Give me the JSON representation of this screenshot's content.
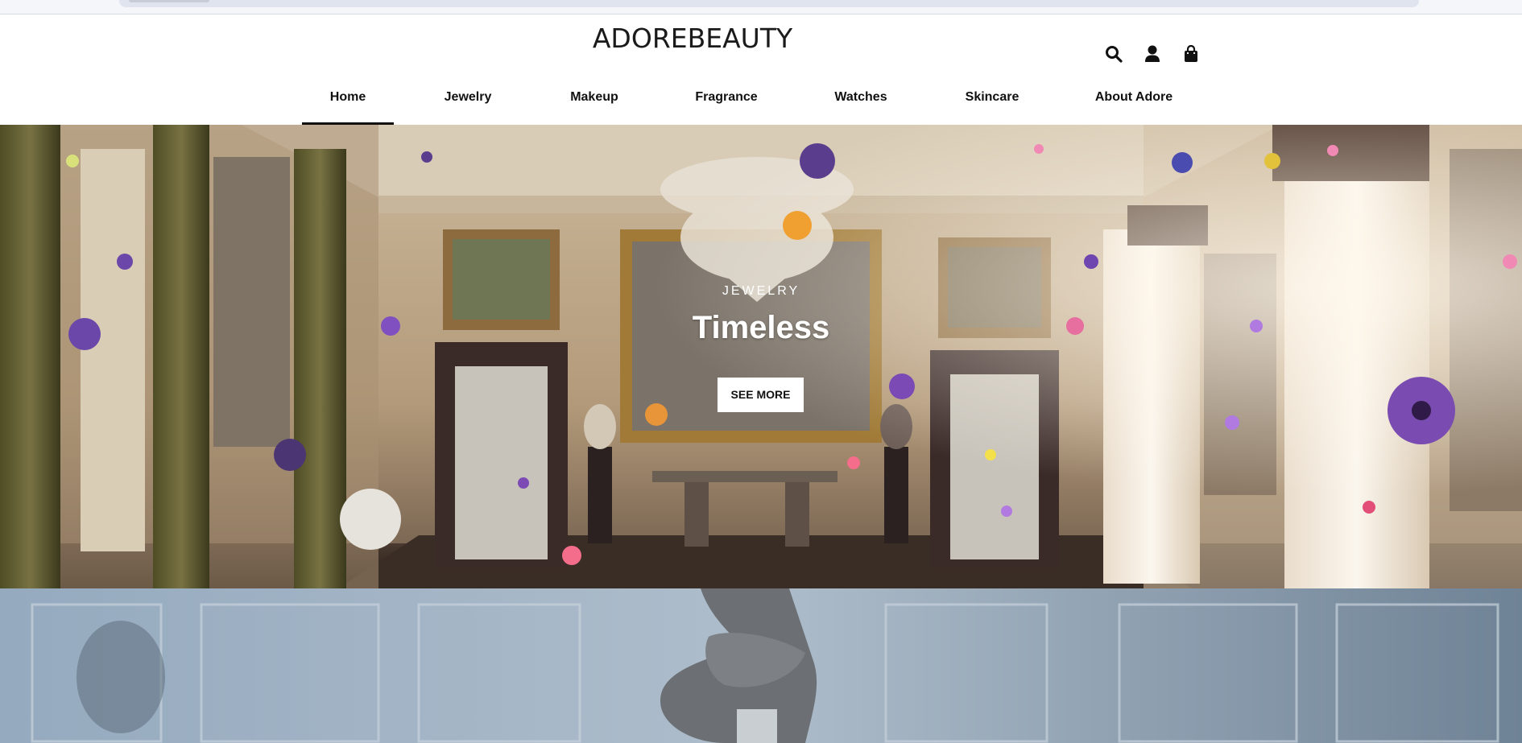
{
  "brand": {
    "logo_text": "ADOREBEAUTY"
  },
  "header": {
    "icons": [
      "search-icon",
      "user-icon",
      "bag-icon"
    ]
  },
  "nav": {
    "items": [
      {
        "label": "Home",
        "active": true
      },
      {
        "label": "Jewelry",
        "active": false
      },
      {
        "label": "Makeup",
        "active": false
      },
      {
        "label": "Fragrance",
        "active": false
      },
      {
        "label": "Watches",
        "active": false
      },
      {
        "label": "Skincare",
        "active": false
      },
      {
        "label": "About Adore",
        "active": false
      }
    ]
  },
  "hero": {
    "eyebrow": "JEWELRY",
    "title": "Timeless",
    "button_label": "SEE MORE"
  },
  "colors": {
    "text": "#111111",
    "header_bg": "#ffffff",
    "hero_button_bg": "#ffffff"
  }
}
